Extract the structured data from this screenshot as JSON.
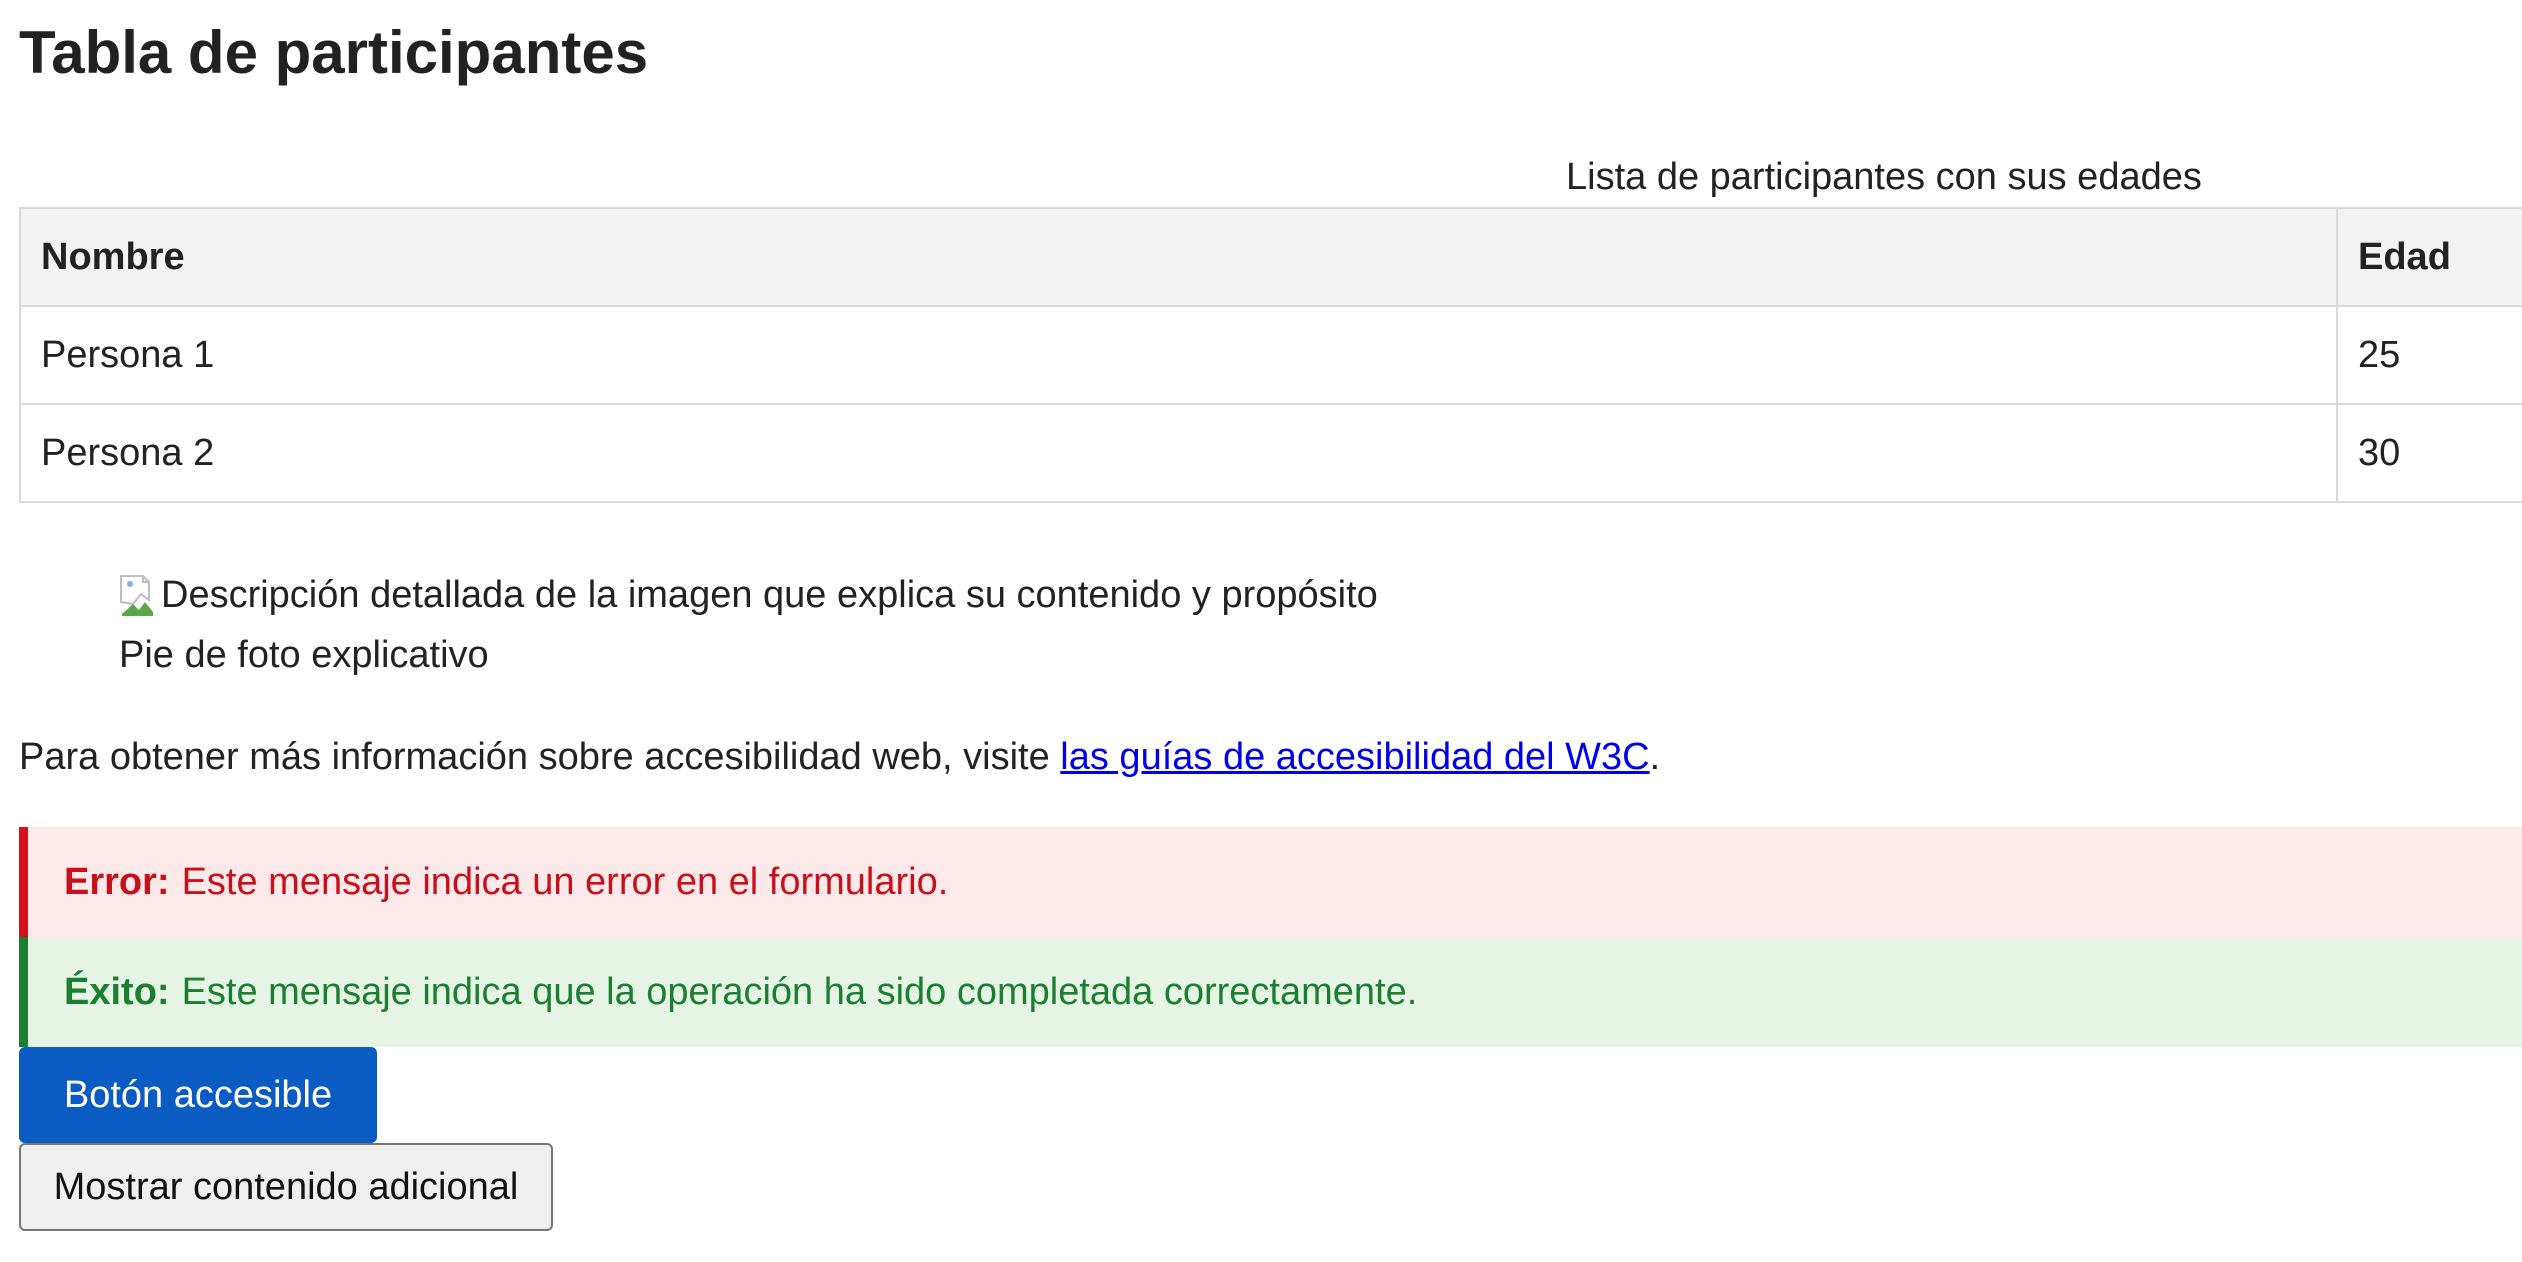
{
  "page": {
    "title": "Tabla de participantes"
  },
  "table": {
    "caption": "Lista de participantes con sus edades",
    "headers": [
      "Nombre",
      "Edad"
    ],
    "rows": [
      [
        "Persona 1",
        "25"
      ],
      [
        "Persona 2",
        "30"
      ]
    ]
  },
  "figure": {
    "alt_text": "Descripción detallada de la imagen que explica su contenido y propósito",
    "caption": "Pie de foto explicativo",
    "icon": "broken-image-icon"
  },
  "info": {
    "text_before": "Para obtener más información sobre accesibilidad web, visite ",
    "link_text": "las guías de accesibilidad del W3C",
    "text_after": "."
  },
  "alerts": {
    "error": {
      "label": "Error:",
      "message": "Este mensaje indica un error en el formulario.",
      "color": "#c8101a",
      "background": "#fde8ea"
    },
    "success": {
      "label": "Éxito:",
      "message": "Este mensaje indica que la operación ha sido completada correctamente.",
      "color": "#1a7f2f",
      "background": "#e6f4e6"
    }
  },
  "buttons": {
    "accessible_label": "Botón accesible",
    "accessible_color": "#0b5cc2",
    "show_more_label": "Mostrar contenido adicional"
  }
}
